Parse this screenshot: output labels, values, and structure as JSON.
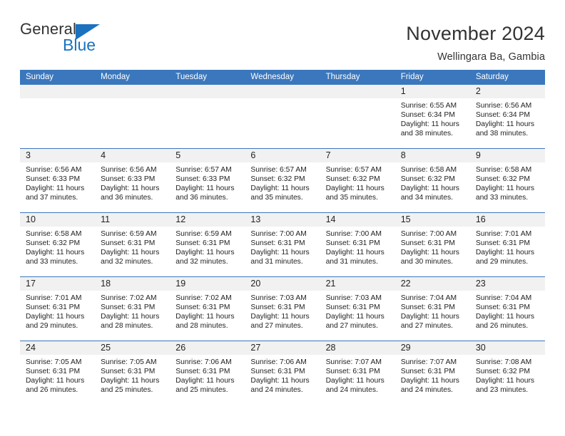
{
  "logo": {
    "word_one": "General",
    "word_two": "Blue",
    "flag_color": "#1b72bf"
  },
  "header": {
    "month_title": "November 2024",
    "location": "Wellingara Ba, Gambia",
    "accent_color": "#3b77bc"
  },
  "weekdays": [
    "Sunday",
    "Monday",
    "Tuesday",
    "Wednesday",
    "Thursday",
    "Friday",
    "Saturday"
  ],
  "weeks": [
    [
      {
        "day": ""
      },
      {
        "day": ""
      },
      {
        "day": ""
      },
      {
        "day": ""
      },
      {
        "day": ""
      },
      {
        "day": "1",
        "sunrise": "Sunrise: 6:55 AM",
        "sunset": "Sunset: 6:34 PM",
        "daylight_line1": "Daylight: 11 hours",
        "daylight_line2": "and 38 minutes."
      },
      {
        "day": "2",
        "sunrise": "Sunrise: 6:56 AM",
        "sunset": "Sunset: 6:34 PM",
        "daylight_line1": "Daylight: 11 hours",
        "daylight_line2": "and 38 minutes."
      }
    ],
    [
      {
        "day": "3",
        "sunrise": "Sunrise: 6:56 AM",
        "sunset": "Sunset: 6:33 PM",
        "daylight_line1": "Daylight: 11 hours",
        "daylight_line2": "and 37 minutes."
      },
      {
        "day": "4",
        "sunrise": "Sunrise: 6:56 AM",
        "sunset": "Sunset: 6:33 PM",
        "daylight_line1": "Daylight: 11 hours",
        "daylight_line2": "and 36 minutes."
      },
      {
        "day": "5",
        "sunrise": "Sunrise: 6:57 AM",
        "sunset": "Sunset: 6:33 PM",
        "daylight_line1": "Daylight: 11 hours",
        "daylight_line2": "and 36 minutes."
      },
      {
        "day": "6",
        "sunrise": "Sunrise: 6:57 AM",
        "sunset": "Sunset: 6:32 PM",
        "daylight_line1": "Daylight: 11 hours",
        "daylight_line2": "and 35 minutes."
      },
      {
        "day": "7",
        "sunrise": "Sunrise: 6:57 AM",
        "sunset": "Sunset: 6:32 PM",
        "daylight_line1": "Daylight: 11 hours",
        "daylight_line2": "and 35 minutes."
      },
      {
        "day": "8",
        "sunrise": "Sunrise: 6:58 AM",
        "sunset": "Sunset: 6:32 PM",
        "daylight_line1": "Daylight: 11 hours",
        "daylight_line2": "and 34 minutes."
      },
      {
        "day": "9",
        "sunrise": "Sunrise: 6:58 AM",
        "sunset": "Sunset: 6:32 PM",
        "daylight_line1": "Daylight: 11 hours",
        "daylight_line2": "and 33 minutes."
      }
    ],
    [
      {
        "day": "10",
        "sunrise": "Sunrise: 6:58 AM",
        "sunset": "Sunset: 6:32 PM",
        "daylight_line1": "Daylight: 11 hours",
        "daylight_line2": "and 33 minutes."
      },
      {
        "day": "11",
        "sunrise": "Sunrise: 6:59 AM",
        "sunset": "Sunset: 6:31 PM",
        "daylight_line1": "Daylight: 11 hours",
        "daylight_line2": "and 32 minutes."
      },
      {
        "day": "12",
        "sunrise": "Sunrise: 6:59 AM",
        "sunset": "Sunset: 6:31 PM",
        "daylight_line1": "Daylight: 11 hours",
        "daylight_line2": "and 32 minutes."
      },
      {
        "day": "13",
        "sunrise": "Sunrise: 7:00 AM",
        "sunset": "Sunset: 6:31 PM",
        "daylight_line1": "Daylight: 11 hours",
        "daylight_line2": "and 31 minutes."
      },
      {
        "day": "14",
        "sunrise": "Sunrise: 7:00 AM",
        "sunset": "Sunset: 6:31 PM",
        "daylight_line1": "Daylight: 11 hours",
        "daylight_line2": "and 31 minutes."
      },
      {
        "day": "15",
        "sunrise": "Sunrise: 7:00 AM",
        "sunset": "Sunset: 6:31 PM",
        "daylight_line1": "Daylight: 11 hours",
        "daylight_line2": "and 30 minutes."
      },
      {
        "day": "16",
        "sunrise": "Sunrise: 7:01 AM",
        "sunset": "Sunset: 6:31 PM",
        "daylight_line1": "Daylight: 11 hours",
        "daylight_line2": "and 29 minutes."
      }
    ],
    [
      {
        "day": "17",
        "sunrise": "Sunrise: 7:01 AM",
        "sunset": "Sunset: 6:31 PM",
        "daylight_line1": "Daylight: 11 hours",
        "daylight_line2": "and 29 minutes."
      },
      {
        "day": "18",
        "sunrise": "Sunrise: 7:02 AM",
        "sunset": "Sunset: 6:31 PM",
        "daylight_line1": "Daylight: 11 hours",
        "daylight_line2": "and 28 minutes."
      },
      {
        "day": "19",
        "sunrise": "Sunrise: 7:02 AM",
        "sunset": "Sunset: 6:31 PM",
        "daylight_line1": "Daylight: 11 hours",
        "daylight_line2": "and 28 minutes."
      },
      {
        "day": "20",
        "sunrise": "Sunrise: 7:03 AM",
        "sunset": "Sunset: 6:31 PM",
        "daylight_line1": "Daylight: 11 hours",
        "daylight_line2": "and 27 minutes."
      },
      {
        "day": "21",
        "sunrise": "Sunrise: 7:03 AM",
        "sunset": "Sunset: 6:31 PM",
        "daylight_line1": "Daylight: 11 hours",
        "daylight_line2": "and 27 minutes."
      },
      {
        "day": "22",
        "sunrise": "Sunrise: 7:04 AM",
        "sunset": "Sunset: 6:31 PM",
        "daylight_line1": "Daylight: 11 hours",
        "daylight_line2": "and 27 minutes."
      },
      {
        "day": "23",
        "sunrise": "Sunrise: 7:04 AM",
        "sunset": "Sunset: 6:31 PM",
        "daylight_line1": "Daylight: 11 hours",
        "daylight_line2": "and 26 minutes."
      }
    ],
    [
      {
        "day": "24",
        "sunrise": "Sunrise: 7:05 AM",
        "sunset": "Sunset: 6:31 PM",
        "daylight_line1": "Daylight: 11 hours",
        "daylight_line2": "and 26 minutes."
      },
      {
        "day": "25",
        "sunrise": "Sunrise: 7:05 AM",
        "sunset": "Sunset: 6:31 PM",
        "daylight_line1": "Daylight: 11 hours",
        "daylight_line2": "and 25 minutes."
      },
      {
        "day": "26",
        "sunrise": "Sunrise: 7:06 AM",
        "sunset": "Sunset: 6:31 PM",
        "daylight_line1": "Daylight: 11 hours",
        "daylight_line2": "and 25 minutes."
      },
      {
        "day": "27",
        "sunrise": "Sunrise: 7:06 AM",
        "sunset": "Sunset: 6:31 PM",
        "daylight_line1": "Daylight: 11 hours",
        "daylight_line2": "and 24 minutes."
      },
      {
        "day": "28",
        "sunrise": "Sunrise: 7:07 AM",
        "sunset": "Sunset: 6:31 PM",
        "daylight_line1": "Daylight: 11 hours",
        "daylight_line2": "and 24 minutes."
      },
      {
        "day": "29",
        "sunrise": "Sunrise: 7:07 AM",
        "sunset": "Sunset: 6:31 PM",
        "daylight_line1": "Daylight: 11 hours",
        "daylight_line2": "and 24 minutes."
      },
      {
        "day": "30",
        "sunrise": "Sunrise: 7:08 AM",
        "sunset": "Sunset: 6:32 PM",
        "daylight_line1": "Daylight: 11 hours",
        "daylight_line2": "and 23 minutes."
      }
    ]
  ]
}
